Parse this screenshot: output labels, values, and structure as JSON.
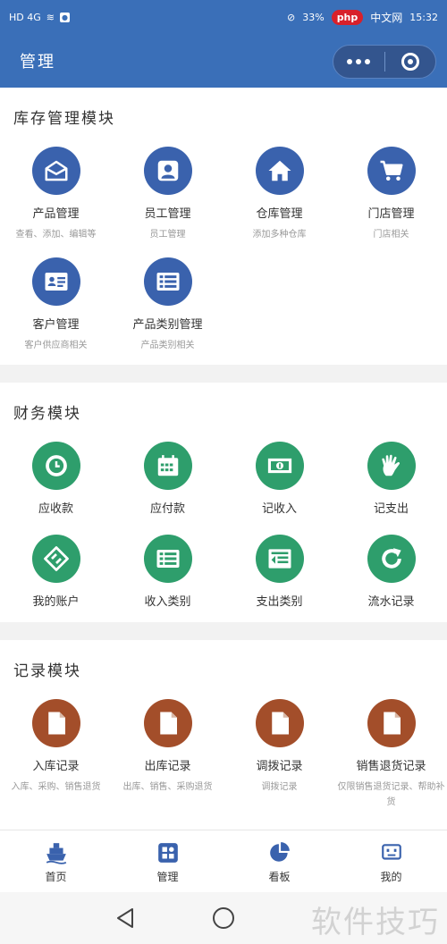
{
  "statusbar": {
    "signal": "HD 4G",
    "battery": "33%",
    "time": "15:32",
    "badge_logo": "php",
    "badge_text": "中文网"
  },
  "navbar": {
    "title": "管理"
  },
  "inventory": {
    "title": "库存管理模块",
    "items": [
      {
        "label": "产品管理",
        "sub": "查看、添加、编辑等",
        "icon": "envelope-open-icon"
      },
      {
        "label": "员工管理",
        "sub": "员工管理",
        "icon": "user-icon"
      },
      {
        "label": "仓库管理",
        "sub": "添加多种仓库",
        "icon": "home-icon"
      },
      {
        "label": "门店管理",
        "sub": "门店相关",
        "icon": "cart-icon"
      },
      {
        "label": "客户管理",
        "sub": "客户供应商相关",
        "icon": "contact-card-icon"
      },
      {
        "label": "产品类别管理",
        "sub": "产品类别相关",
        "icon": "list-icon"
      }
    ]
  },
  "finance": {
    "title": "财务模块",
    "items": [
      {
        "label": "应收款",
        "icon": "clock-icon"
      },
      {
        "label": "应付款",
        "icon": "calendar-icon"
      },
      {
        "label": "记收入",
        "icon": "money-icon"
      },
      {
        "label": "记支出",
        "icon": "hand-icon"
      },
      {
        "label": "我的账户",
        "icon": "transfer-icon"
      },
      {
        "label": "收入类别",
        "icon": "list-icon"
      },
      {
        "label": "支出类别",
        "icon": "indent-list-icon"
      },
      {
        "label": "流水记录",
        "icon": "refresh-icon"
      }
    ]
  },
  "records": {
    "title": "记录模块",
    "items": [
      {
        "label": "入库记录",
        "sub": "入库、采购、销售退货",
        "icon": "file-icon"
      },
      {
        "label": "出库记录",
        "sub": "出库、销售、采购退货",
        "icon": "file-icon"
      },
      {
        "label": "调拨记录",
        "sub": "调拨记录",
        "icon": "file-icon"
      },
      {
        "label": "销售退货记录",
        "sub": "仅限销售退货记录、帮助补货",
        "icon": "file-icon"
      }
    ]
  },
  "tabbar": {
    "items": [
      {
        "label": "首页",
        "icon": "ship-icon"
      },
      {
        "label": "管理",
        "icon": "apps-icon"
      },
      {
        "label": "看板",
        "icon": "pie-chart-icon"
      },
      {
        "label": "我的",
        "icon": "robot-icon"
      }
    ]
  },
  "watermark": "软件技巧",
  "colors": {
    "primary": "#3a6fb8",
    "blue_icon": "#3a62ad",
    "green_icon": "#2e9e6c",
    "brown_icon": "#a34e2a"
  }
}
